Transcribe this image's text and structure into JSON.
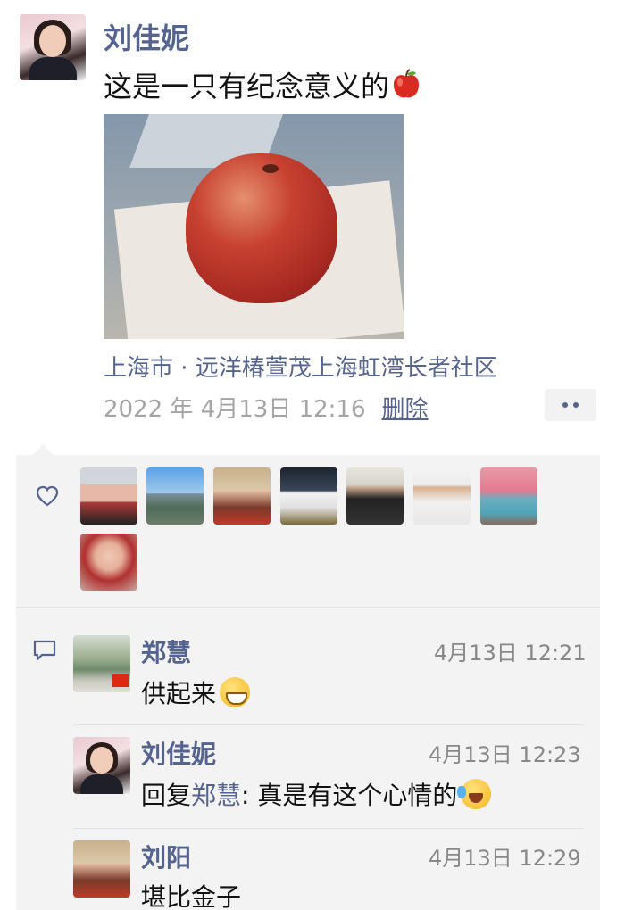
{
  "post": {
    "author": "刘佳妮",
    "text": "这是一只有纪念意义的",
    "text_emoji": "apple-emoji",
    "location": "上海市 · 远洋椿萱茂上海虹湾长者社区",
    "timestamp": "2022 年 4月13日 12:16",
    "delete_label": "删除",
    "more_icon": "more-dots-icon"
  },
  "likes": {
    "icon": "heart-icon",
    "avatars": [
      "avatar-1",
      "avatar-2",
      "avatar-3",
      "avatar-4",
      "avatar-5",
      "avatar-6",
      "avatar-7",
      "avatar-8"
    ]
  },
  "comments": {
    "icon": "comment-bubble-icon",
    "items": [
      {
        "name": "郑慧",
        "time": "4月13日 12:21",
        "text": "供起来",
        "emoji": "grin-emoji"
      },
      {
        "name": "刘佳妮",
        "time": "4月13日 12:23",
        "reply_prefix": "回复",
        "reply_to": "郑慧",
        "text": ": 真是有这个心情的",
        "emoji": "laugh-cry-emoji"
      },
      {
        "name": "刘阳",
        "time": "4月13日 12:29",
        "text": "堪比金子"
      }
    ]
  },
  "colors": {
    "link": "#55638f",
    "panel_bg": "#f3f3f3",
    "meta_gray": "#a4a4a4"
  }
}
